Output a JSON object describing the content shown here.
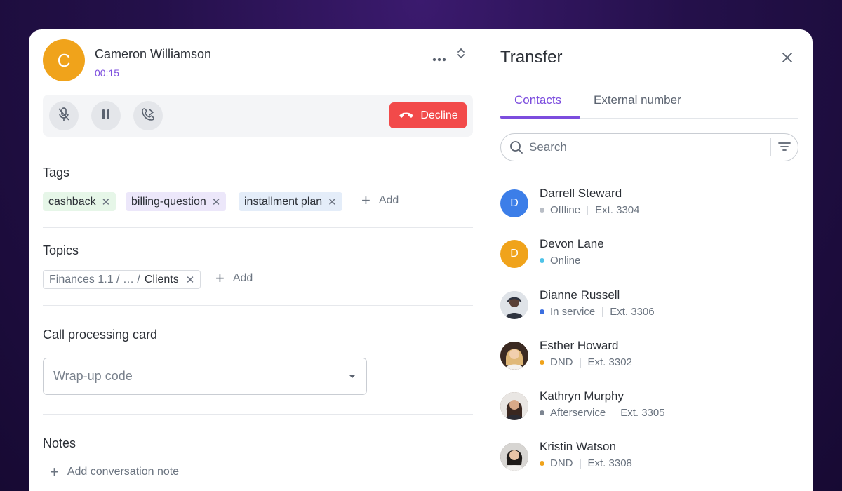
{
  "caller": {
    "initial": "C",
    "name": "Cameron Williamson",
    "timer": "00:15",
    "decline_label": "Decline"
  },
  "tags": {
    "title": "Tags",
    "items": [
      {
        "label": "cashback",
        "color": "#e6f6e8"
      },
      {
        "label": "billing-question",
        "color": "#ece7fa"
      },
      {
        "label": "installment plan",
        "color": "#e4edf9"
      }
    ],
    "add_label": "Add"
  },
  "topics": {
    "title": "Topics",
    "chip_path": "Finances 1.1 / … /",
    "chip_leaf": "Clients",
    "add_label": "Add"
  },
  "call_card": {
    "title": "Call processing card",
    "wrapup_placeholder": "Wrap-up code"
  },
  "notes": {
    "title": "Notes",
    "add_label": "Add conversation note"
  },
  "transfer": {
    "title": "Transfer",
    "tabs": [
      {
        "label": "Contacts",
        "active": true
      },
      {
        "label": "External number",
        "active": false
      }
    ],
    "search_placeholder": "Search",
    "contacts": [
      {
        "initial": "D",
        "avatar_color": "#3c7ee8",
        "name": "Darrell Steward",
        "status": "Offline",
        "status_color": "#b9bec6",
        "ext": "Ext. 3304"
      },
      {
        "initial": "D",
        "avatar_color": "#f0a31b",
        "name": "Devon Lane",
        "status": "Online",
        "status_color": "#4fc3e8",
        "ext": ""
      },
      {
        "initial": "",
        "avatar_color": "#cfd4da",
        "name": "Dianne Russell",
        "status": "In service",
        "status_color": "#3c6fe0",
        "ext": "Ext. 3306"
      },
      {
        "initial": "",
        "avatar_color": "#8a6a4e",
        "name": "Esther Howard",
        "status": "DND",
        "status_color": "#f0a31b",
        "ext": "Ext. 3302"
      },
      {
        "initial": "",
        "avatar_color": "#6e5243",
        "name": "Kathryn Murphy",
        "status": "Afterservice",
        "status_color": "#7d8591",
        "ext": "Ext. 3305"
      },
      {
        "initial": "",
        "avatar_color": "#4a3b35",
        "name": "Kristin Watson",
        "status": "DND",
        "status_color": "#f0a31b",
        "ext": "Ext. 3308"
      }
    ]
  }
}
